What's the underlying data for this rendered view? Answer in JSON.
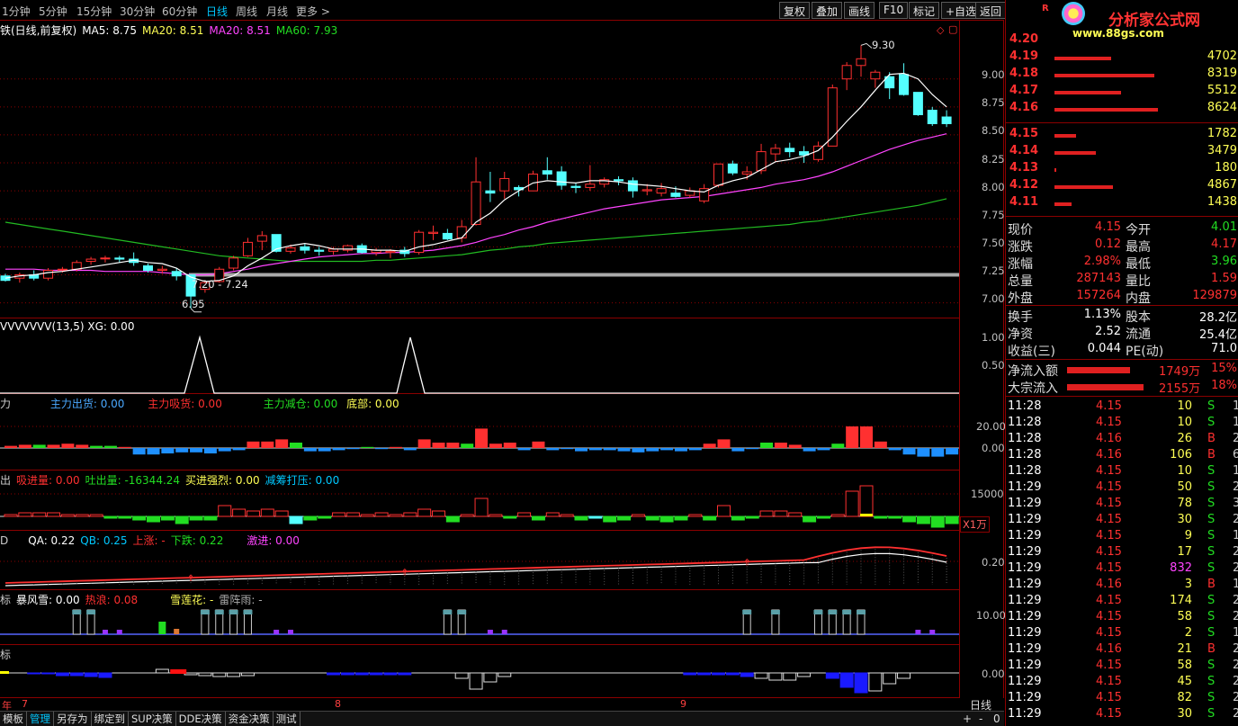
{
  "colors": {
    "up": "#ff3030",
    "down": "#54ffff",
    "ma5": "#ffffff",
    "ma20": "#ff44ff",
    "ma60": "#22bb22",
    "grid": "#8b0000",
    "green": "#22dd22",
    "blue": "#1e90ff",
    "yellow": "#ffff00",
    "purple": "#9933ff"
  },
  "topbar": {
    "periods": [
      "1分钟",
      "5分钟",
      "15分钟",
      "30分钟",
      "60分钟",
      "日线",
      "周线",
      "月线",
      "更多 >"
    ],
    "active": "日线",
    "buttons": [
      "复权",
      "叠加",
      "画线",
      "F10",
      "标记",
      "+自选",
      "返回"
    ]
  },
  "main": {
    "legend": {
      "name": "铁(日线,前复权)",
      "ma5": "MA5: 8.75",
      "ma20a": "MA20: 8.51",
      "ma20b": "MA20: 8.51",
      "ma60": "MA60: 7.93"
    },
    "high_label": "9.30",
    "low_label": "6.95",
    "range_label": "7.20 - 7.24",
    "yticks": [
      "9.00",
      "8.75",
      "8.50",
      "8.25",
      "8.00",
      "7.75",
      "7.50",
      "7.25",
      "7.00"
    ]
  },
  "chart_data": {
    "type": "candlestick",
    "ylim": [
      6.86,
      9.52
    ],
    "candles": [
      [
        7.24,
        7.26,
        7.2,
        7.19
      ],
      [
        7.22,
        7.27,
        7.25,
        7.18
      ],
      [
        7.25,
        7.29,
        7.22,
        7.2
      ],
      [
        7.22,
        7.31,
        7.29,
        7.2
      ],
      [
        7.3,
        7.32,
        7.3,
        7.27
      ],
      [
        7.3,
        7.38,
        7.36,
        7.28
      ],
      [
        7.37,
        7.41,
        7.39,
        7.34
      ],
      [
        7.4,
        7.42,
        7.4,
        7.36
      ],
      [
        7.4,
        7.42,
        7.39,
        7.36
      ],
      [
        7.39,
        7.45,
        7.36,
        7.33
      ],
      [
        7.33,
        7.35,
        7.29,
        7.27
      ],
      [
        7.29,
        7.33,
        7.3,
        7.26
      ],
      [
        7.28,
        7.31,
        7.24,
        7.2
      ],
      [
        7.25,
        7.25,
        7.06,
        6.95
      ],
      [
        7.12,
        7.2,
        7.18,
        7.09
      ],
      [
        7.19,
        7.32,
        7.3,
        7.18
      ],
      [
        7.31,
        7.42,
        7.4,
        7.29
      ],
      [
        7.42,
        7.58,
        7.54,
        7.41
      ],
      [
        7.55,
        7.64,
        7.6,
        7.47
      ],
      [
        7.61,
        7.61,
        7.46,
        7.45
      ],
      [
        7.46,
        7.52,
        7.49,
        7.44
      ],
      [
        7.5,
        7.53,
        7.47,
        7.44
      ],
      [
        7.47,
        7.5,
        7.46,
        7.42
      ],
      [
        7.46,
        7.5,
        7.48,
        7.43
      ],
      [
        7.47,
        7.52,
        7.51,
        7.45
      ],
      [
        7.51,
        7.53,
        7.45,
        7.44
      ],
      [
        7.45,
        7.49,
        7.47,
        7.42
      ],
      [
        7.45,
        7.48,
        7.46,
        7.4
      ],
      [
        7.47,
        7.5,
        7.44,
        7.41
      ],
      [
        7.45,
        7.65,
        7.63,
        7.43
      ],
      [
        7.62,
        7.69,
        7.63,
        7.56
      ],
      [
        7.62,
        7.66,
        7.57,
        7.56
      ],
      [
        7.58,
        7.74,
        7.68,
        7.54
      ],
      [
        7.7,
        8.3,
        8.08,
        7.69
      ],
      [
        8.0,
        8.17,
        7.98,
        7.9
      ],
      [
        8.0,
        8.17,
        8.11,
        7.93
      ],
      [
        8.03,
        8.05,
        8.01,
        7.95
      ],
      [
        8.0,
        8.18,
        8.15,
        8.0
      ],
      [
        8.18,
        8.3,
        8.15,
        8.1
      ],
      [
        8.17,
        8.22,
        8.05,
        8.01
      ],
      [
        8.04,
        8.07,
        8.03,
        7.98
      ],
      [
        8.03,
        8.23,
        8.06,
        8.0
      ],
      [
        8.06,
        8.12,
        8.1,
        8.03
      ],
      [
        8.1,
        8.13,
        8.09,
        8.05
      ],
      [
        8.09,
        8.12,
        8.0,
        7.94
      ],
      [
        8.0,
        8.06,
        8.01,
        7.96
      ],
      [
        7.98,
        8.07,
        8.02,
        7.95
      ],
      [
        7.98,
        8.04,
        7.95,
        7.94
      ],
      [
        7.96,
        8.03,
        8.0,
        7.94
      ],
      [
        7.91,
        8.06,
        8.02,
        7.89
      ],
      [
        8.05,
        8.24,
        8.24,
        8.03
      ],
      [
        8.24,
        8.27,
        8.16,
        8.14
      ],
      [
        8.15,
        8.22,
        8.17,
        8.1
      ],
      [
        8.18,
        8.42,
        8.35,
        8.15
      ],
      [
        8.33,
        8.42,
        8.38,
        8.26
      ],
      [
        8.38,
        8.43,
        8.35,
        8.3
      ],
      [
        8.35,
        8.4,
        8.32,
        8.25
      ],
      [
        8.28,
        8.44,
        8.4,
        8.26
      ],
      [
        8.4,
        8.95,
        8.92,
        8.4
      ],
      [
        9.0,
        9.15,
        9.12,
        8.9
      ],
      [
        9.12,
        9.3,
        9.18,
        9.02
      ],
      [
        9.0,
        9.08,
        9.06,
        8.92
      ],
      [
        9.02,
        9.06,
        8.92,
        8.82
      ],
      [
        9.04,
        9.14,
        8.86,
        8.85
      ],
      [
        8.88,
        8.88,
        8.68,
        8.67
      ],
      [
        8.72,
        8.75,
        8.6,
        8.58
      ],
      [
        8.66,
        8.72,
        8.6,
        8.57
      ]
    ],
    "ma5": [
      7.22,
      7.24,
      7.25,
      7.27,
      7.28,
      7.3,
      7.32,
      7.34,
      7.36,
      7.38,
      7.36,
      7.35,
      7.31,
      7.23,
      7.19,
      7.2,
      7.24,
      7.33,
      7.4,
      7.48,
      7.51,
      7.53,
      7.51,
      7.48,
      7.48,
      7.48,
      7.47,
      7.47,
      7.46,
      7.5,
      7.52,
      7.55,
      7.58,
      7.72,
      7.8,
      7.92,
      8.0,
      8.07,
      8.09,
      8.08,
      8.07,
      8.09,
      8.09,
      8.08,
      8.06,
      8.05,
      8.04,
      8.02,
      8.0,
      7.99,
      8.05,
      8.09,
      8.12,
      8.19,
      8.26,
      8.28,
      8.31,
      8.36,
      8.48,
      8.62,
      8.75,
      8.9,
      9.04,
      9.05,
      9.0,
      8.86,
      8.75
    ],
    "ma20": [
      7.3,
      7.3,
      7.3,
      7.29,
      7.29,
      7.29,
      7.29,
      7.28,
      7.28,
      7.28,
      7.28,
      7.27,
      7.26,
      7.25,
      7.25,
      7.26,
      7.28,
      7.3,
      7.33,
      7.35,
      7.37,
      7.39,
      7.41,
      7.42,
      7.43,
      7.44,
      7.44,
      7.45,
      7.45,
      7.46,
      7.47,
      7.49,
      7.51,
      7.54,
      7.58,
      7.61,
      7.65,
      7.68,
      7.72,
      7.75,
      7.78,
      7.81,
      7.84,
      7.86,
      7.88,
      7.9,
      7.92,
      7.93,
      7.94,
      7.95,
      7.97,
      7.99,
      8.01,
      8.03,
      8.06,
      8.08,
      8.1,
      8.13,
      8.17,
      8.22,
      8.27,
      8.32,
      8.37,
      8.41,
      8.45,
      8.48,
      8.51
    ],
    "ma60": [
      7.72,
      7.7,
      7.68,
      7.66,
      7.64,
      7.62,
      7.6,
      7.58,
      7.56,
      7.54,
      7.52,
      7.5,
      7.48,
      7.46,
      7.44,
      7.42,
      7.41,
      7.4,
      7.39,
      7.38,
      7.37,
      7.37,
      7.37,
      7.37,
      7.37,
      7.37,
      7.38,
      7.38,
      7.39,
      7.4,
      7.41,
      7.42,
      7.43,
      7.45,
      7.47,
      7.48,
      7.5,
      7.51,
      7.53,
      7.54,
      7.55,
      7.56,
      7.57,
      7.58,
      7.59,
      7.6,
      7.61,
      7.62,
      7.63,
      7.64,
      7.65,
      7.66,
      7.67,
      7.68,
      7.69,
      7.7,
      7.72,
      7.73,
      7.75,
      7.77,
      7.79,
      7.81,
      7.83,
      7.85,
      7.87,
      7.9,
      7.93
    ]
  },
  "pane2": {
    "title": "VVVVVVV(13,5) XG: 0.00",
    "yticks": [
      "1.00",
      "0.50"
    ]
  },
  "pane3": {
    "prefix": "力",
    "a": "主力出货: 0.00",
    "b": "主力吸货: 0.00",
    "c": "主力减仓: 0.00",
    "d": "底部: 0.00",
    "yticks": [
      "20.00",
      "0.00"
    ]
  },
  "pane4": {
    "prefix": "出",
    "a": "吸进量: 0.00",
    "b": "吐出量: -16344.24",
    "c": "买进强烈: 0.00",
    "d": "减筹打压: 0.00",
    "yticks": [
      "15000"
    ],
    "unit": "X1万"
  },
  "pane5": {
    "prefix": "D",
    "a": "QA: 0.22",
    "b": "QB: 0.25",
    "c": "上涨: -",
    "d": "下跌: 0.22",
    "e": "激进: 0.00",
    "yticks": [
      "0.20"
    ]
  },
  "pane6": {
    "prefix": "标",
    "a": "暴风雪: 0.00",
    "b": "热浪: 0.08",
    "c": "雪莲花: -",
    "d": "雷阵雨: -",
    "yticks": [
      "10.00"
    ]
  },
  "pane7": {
    "prefix": "标",
    "yticks": [
      "0.00"
    ]
  },
  "dates": {
    "a": "年",
    "b": "7",
    "c": "8",
    "d": "9"
  },
  "bottom": {
    "tabs": [
      "模板",
      "管理",
      "另存为",
      "绑定到",
      "SUP决策",
      "DDE决策",
      "资金决策",
      "测试"
    ],
    "period": "日线"
  },
  "right": {
    "logo": "分析家公式网",
    "logo_url": "www.88gs.com",
    "asks": [
      [
        "4.20",
        ""
      ],
      [
        "4.19",
        "4702"
      ],
      [
        "4.18",
        "8319"
      ],
      [
        "4.17",
        "5512"
      ],
      [
        "4.16",
        "8624"
      ]
    ],
    "bids": [
      [
        "4.15",
        "1782"
      ],
      [
        "4.14",
        "3479"
      ],
      [
        "4.13",
        "180"
      ],
      [
        "4.12",
        "4867"
      ],
      [
        "4.11",
        "1438"
      ]
    ],
    "stats": [
      [
        "现价",
        "4.15",
        "今开",
        "4.01"
      ],
      [
        "涨跌",
        "0.12",
        "最高",
        "4.17"
      ],
      [
        "涨幅",
        "2.98%",
        "最低",
        "3.96"
      ],
      [
        "总量",
        "287143",
        "量比",
        "1.59"
      ],
      [
        "外盘",
        "157264",
        "内盘",
        "129879"
      ]
    ],
    "stats2": [
      [
        "换手",
        "1.13%",
        "股本",
        "28.2亿"
      ],
      [
        "净资",
        "2.52",
        "流通",
        "25.4亿"
      ],
      [
        "收益(三)",
        "0.044",
        "PE(动)",
        "71.0"
      ]
    ],
    "flows": [
      [
        "净流入额",
        "1749万",
        "15%"
      ],
      [
        "大宗流入",
        "2155万",
        "18%"
      ]
    ],
    "ticks": [
      [
        "11:28",
        "4.15",
        "10",
        "S",
        "1"
      ],
      [
        "11:28",
        "4.15",
        "10",
        "S",
        "1"
      ],
      [
        "11:28",
        "4.16",
        "26",
        "B",
        "2"
      ],
      [
        "11:28",
        "4.16",
        "106",
        "B",
        "6"
      ],
      [
        "11:28",
        "4.15",
        "10",
        "S",
        "1"
      ],
      [
        "11:29",
        "4.15",
        "50",
        "S",
        "2"
      ],
      [
        "11:29",
        "4.15",
        "78",
        "S",
        "3"
      ],
      [
        "11:29",
        "4.15",
        "30",
        "S",
        "2"
      ],
      [
        "11:29",
        "4.15",
        "9",
        "S",
        "1"
      ],
      [
        "11:29",
        "4.15",
        "17",
        "S",
        "2"
      ],
      [
        "11:29",
        "4.15",
        "832",
        "S",
        "2"
      ],
      [
        "11:29",
        "4.16",
        "3",
        "B",
        "1"
      ],
      [
        "11:29",
        "4.15",
        "174",
        "S",
        "2"
      ],
      [
        "11:29",
        "4.15",
        "58",
        "S",
        "2"
      ],
      [
        "11:29",
        "4.15",
        "2",
        "S",
        "1"
      ],
      [
        "11:29",
        "4.16",
        "21",
        "B",
        "2"
      ],
      [
        "11:29",
        "4.15",
        "58",
        "S",
        "2"
      ],
      [
        "11:29",
        "4.15",
        "45",
        "S",
        "2"
      ],
      [
        "11:29",
        "4.15",
        "82",
        "S",
        "2"
      ],
      [
        "11:29",
        "4.15",
        "30",
        "S",
        "2"
      ]
    ]
  }
}
